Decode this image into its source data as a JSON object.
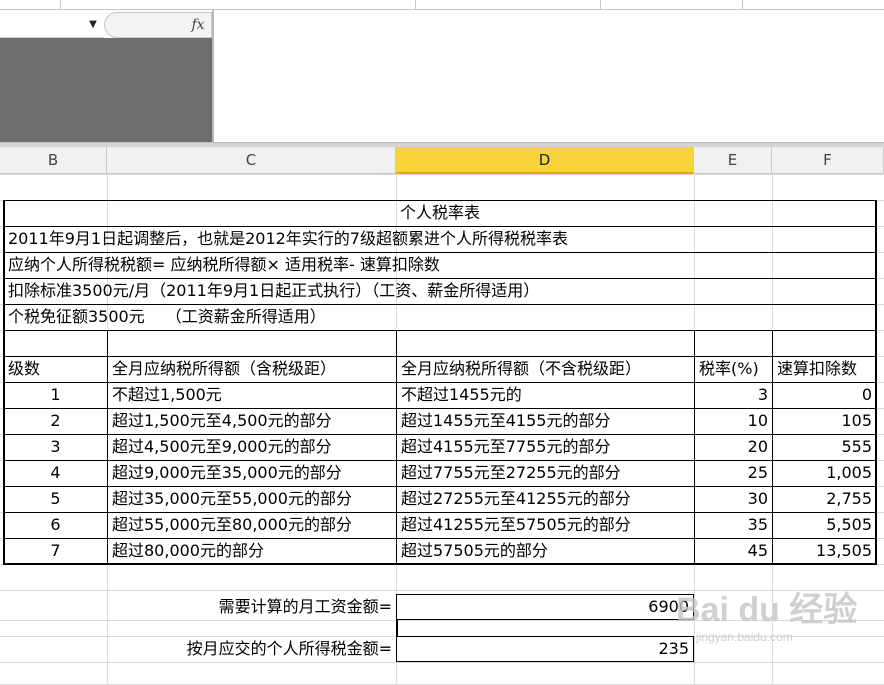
{
  "formula_bar": {
    "fx_label": "fx",
    "name_box_value": ""
  },
  "columns": [
    "B",
    "C",
    "D",
    "E",
    "F"
  ],
  "selected_column": "D",
  "table": {
    "title": "个人税率表",
    "notes": [
      "2011年9月1日起调整后，也就是2012年实行的7级超额累进个人所得税税率表",
      "应纳个人所得税税额= 应纳税所得额× 适用税率- 速算扣除数",
      "扣除标准3500元/月（2011年9月1日起正式执行）（工资、薪金所得适用）",
      "个税免征额3500元　 （工资薪金所得适用）"
    ],
    "headers": {
      "level": "级数",
      "with_tax": "全月应纳税所得额（含税级距）",
      "without_tax": "全月应纳税所得额（不含税级距）",
      "rate": "税率(%)",
      "deduction": "速算扣除数"
    },
    "rows": [
      {
        "level": "1",
        "with_tax": "不超过1,500元",
        "without_tax": "不超过1455元的",
        "rate": "3",
        "deduction": "0"
      },
      {
        "level": "2",
        "with_tax": "超过1,500元至4,500元的部分",
        "without_tax": "超过1455元至4155元的部分",
        "rate": "10",
        "deduction": "105"
      },
      {
        "level": "3",
        "with_tax": "超过4,500元至9,000元的部分",
        "without_tax": "超过4155元至7755元的部分",
        "rate": "20",
        "deduction": "555"
      },
      {
        "level": "4",
        "with_tax": "超过9,000元至35,000元的部分",
        "without_tax": "超过7755元至27255元的部分",
        "rate": "25",
        "deduction": "1,005"
      },
      {
        "level": "5",
        "with_tax": "超过35,000元至55,000元的部分",
        "without_tax": "超过27255元至41255元的部分",
        "rate": "30",
        "deduction": "2,755"
      },
      {
        "level": "6",
        "with_tax": "超过55,000元至80,000元的部分",
        "without_tax": "超过41255元至57505元的部分",
        "rate": "35",
        "deduction": "5,505"
      },
      {
        "level": "7",
        "with_tax": "超过80,000元的部分",
        "without_tax": "超过57505元的部分",
        "rate": "45",
        "deduction": "13,505"
      }
    ]
  },
  "calc": {
    "salary_label": "需要计算的月工资金额=",
    "salary_value": "6900",
    "tax_label": "按月应交的个人所得税金额=",
    "tax_value": "235"
  },
  "watermark": {
    "main": "Bai du 经验",
    "sub": "jingyan.baidu.com"
  }
}
